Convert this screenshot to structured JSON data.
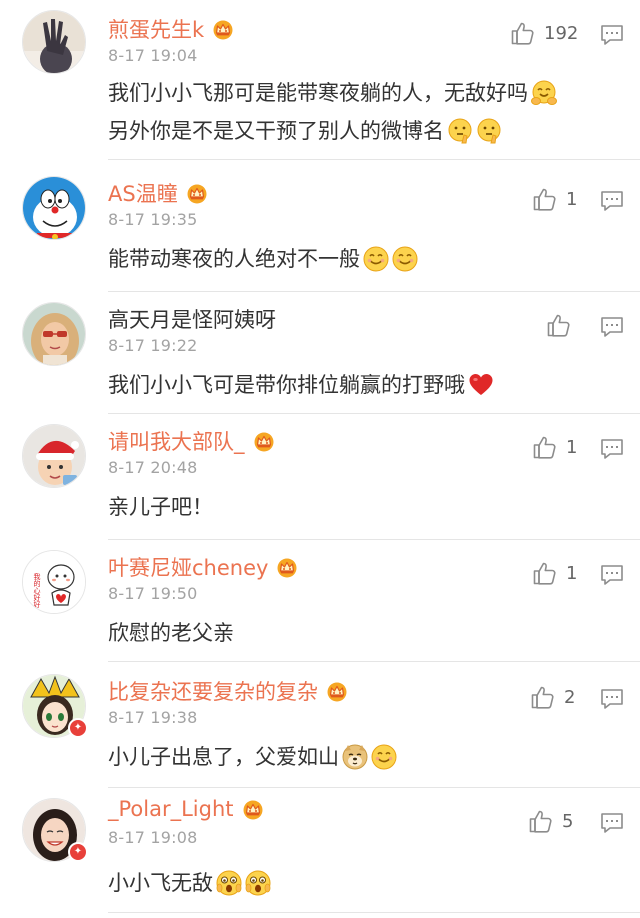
{
  "comments": [
    {
      "username": "煎蛋先生k",
      "time": "8-17 19:04",
      "lines": [
        "我们小小飞那可是能带寒夜躺的人，无敌好吗",
        "另外你是不是又干预了别人的微博名"
      ],
      "likes": "192",
      "avatar": "handprint-avatar",
      "badge": "crown-badge",
      "emojis": [
        "hug-emoji",
        "think-emoji",
        "think-emoji"
      ]
    },
    {
      "username": "AS温瞳",
      "time": "8-17 19:35",
      "lines": [
        "能带动寒夜的人绝对不一般"
      ],
      "likes": "1",
      "avatar": "doraemon-avatar",
      "badge": "crown-badge",
      "emojis": [
        "smile-emoji",
        "smile-emoji"
      ]
    },
    {
      "username": "高天月是怪阿姨呀",
      "time": "8-17 19:22",
      "lines": [
        "我们小小飞可是带你排位躺赢的打野哦"
      ],
      "likes": "",
      "avatar": "girl-sunglasses-avatar",
      "badge": "",
      "emojis": [
        "heart-emoji"
      ]
    },
    {
      "username": "请叫我大部队_",
      "time": "8-17 20:48",
      "lines": [
        "亲儿子吧！"
      ],
      "likes": "1",
      "avatar": "child-santa-hat-avatar",
      "badge": "crown-badge",
      "emojis": []
    },
    {
      "username": "叶赛尼娅cheney",
      "time": "8-17 19:50",
      "lines": [
        "欣慰的老父亲"
      ],
      "likes": "1",
      "avatar": "cartoon-heart-avatar",
      "avatar_text": "我的心好好",
      "badge": "crown-badge",
      "emojis": []
    },
    {
      "username": "比复杂还要复杂的复杂",
      "time": "8-17 19:38",
      "lines": [
        "小儿子出息了，父爱如山"
      ],
      "likes": "2",
      "avatar": "anime-girl-avatar",
      "badge": "crown-badge",
      "emojis": [
        "doge-emoji",
        "smile-emoji"
      ]
    },
    {
      "username": "_Polar_Light",
      "time": "8-17 19:08",
      "lines": [
        "小小飞无敌"
      ],
      "likes": "5",
      "avatar": "woman-smiling-avatar",
      "badge": "crown-badge",
      "emojis": [
        "shocked-emoji",
        "shocked-emoji"
      ]
    }
  ],
  "colors": {
    "username": "#eb7350",
    "timestamp": "#a3a3a3",
    "content": "#333333",
    "icon": "#8c8c8c",
    "divider": "#e5e5e5",
    "verified_badge": "#e8403a"
  },
  "icons": {
    "like": "thumbs-up-icon",
    "reply": "comment-reply-icon",
    "verified": "verified-badge-icon"
  }
}
